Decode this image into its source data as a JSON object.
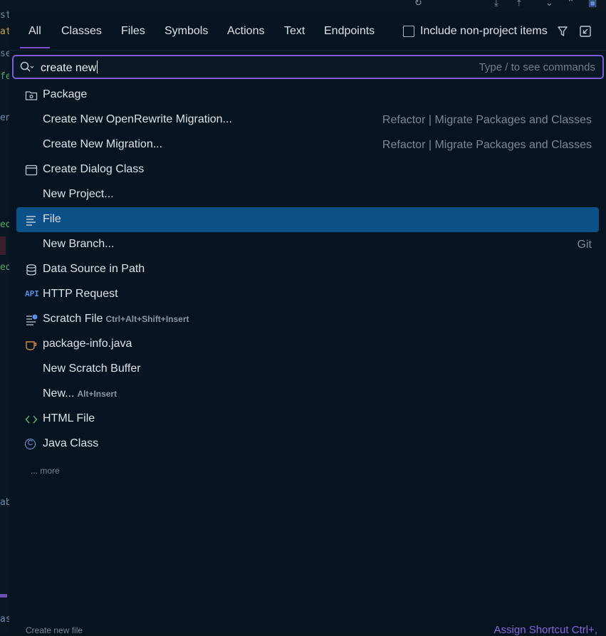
{
  "editor_fragments": [
    "st",
    "at",
    "se",
    "fe",
    "en",
    "ed",
    "ed",
    "ab",
    "as"
  ],
  "tabs": [
    {
      "label": "All",
      "active": true
    },
    {
      "label": "Classes"
    },
    {
      "label": "Files"
    },
    {
      "label": "Symbols"
    },
    {
      "label": "Actions"
    },
    {
      "label": "Text"
    },
    {
      "label": "Endpoints"
    }
  ],
  "include_non_project": {
    "label": "Include non-project items",
    "checked": false
  },
  "search": {
    "value": "create new",
    "hint": "Type / to see commands"
  },
  "results": [
    {
      "label": "Package",
      "icon": "package-folder-icon"
    },
    {
      "label": "Create New OpenRewrite Migration...",
      "hint": "Refactor | Migrate Packages and Classes"
    },
    {
      "label": "Create New Migration...",
      "hint": "Refactor | Migrate Packages and Classes"
    },
    {
      "label": "Create Dialog Class",
      "icon": "dialog-icon"
    },
    {
      "label": "New Project..."
    },
    {
      "label": "File",
      "icon": "file-text-icon",
      "selected": true
    },
    {
      "label": "New Branch...",
      "hint": "Git"
    },
    {
      "label": "Data Source in Path",
      "icon": "database-icon"
    },
    {
      "label": "HTTP Request",
      "icon": "api-icon",
      "icon_text": "API"
    },
    {
      "label": "Scratch File",
      "icon": "scratch-file-icon",
      "shortcut": "Ctrl+Alt+Shift+Insert"
    },
    {
      "label": "package-info.java",
      "icon": "java-cup-icon"
    },
    {
      "label": "New Scratch Buffer"
    },
    {
      "label": "New...",
      "shortcut": "Alt+Insert"
    },
    {
      "label": "HTML File",
      "icon": "html-icon"
    },
    {
      "label": "Java Class",
      "icon": "java-class-icon",
      "icon_text": "C"
    }
  ],
  "more_label": "... more",
  "footer": {
    "left": "Create new file",
    "right": "Assign Shortcut  Ctrl+,"
  },
  "colors": {
    "accent": "#7d5cd6",
    "selection": "#0c5088",
    "background": "#061421"
  }
}
